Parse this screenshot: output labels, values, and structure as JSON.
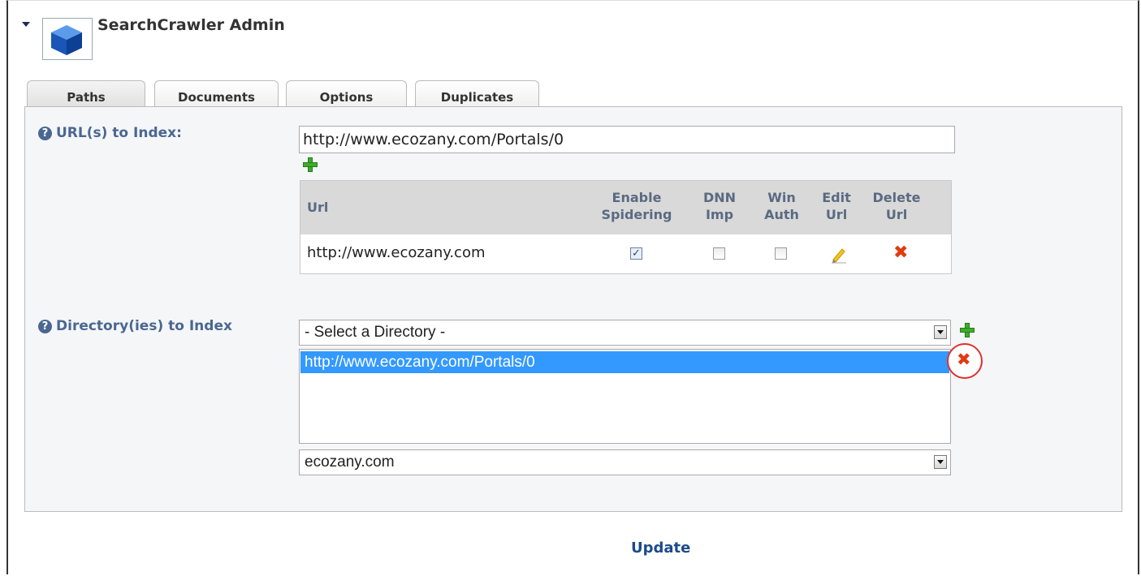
{
  "module": {
    "title": "SearchCrawler Admin",
    "icon": "cube-icon"
  },
  "tabs": [
    {
      "label": "Paths",
      "active": true
    },
    {
      "label": "Documents",
      "active": false
    },
    {
      "label": "Options",
      "active": false
    },
    {
      "label": "Duplicates",
      "active": false
    }
  ],
  "urls_section": {
    "label": "URL(s) to Index:",
    "input_value": "http://www.ecozany.com/Portals/0",
    "table": {
      "headers": {
        "url": "Url",
        "enable_spidering_1": "Enable",
        "enable_spidering_2": "Spidering",
        "dnn_imp_1": "DNN",
        "dnn_imp_2": "Imp",
        "win_auth_1": "Win",
        "win_auth_2": "Auth",
        "edit_url_1": "Edit",
        "edit_url_2": "Url",
        "delete_url_1": "Delete",
        "delete_url_2": "Url"
      },
      "rows": [
        {
          "url": "http://www.ecozany.com",
          "enable_spidering": true,
          "dnn_imp": false,
          "win_auth": false
        }
      ]
    }
  },
  "directories_section": {
    "label": "Directory(ies) to Index",
    "select_value": "- Select a Directory -",
    "list_items": [
      "http://www.ecozany.com/Portals/0"
    ],
    "portal_select_value": "ecozany.com"
  },
  "help_glyph": "?",
  "update_label": "Update",
  "colors": {
    "label": "#4a6791",
    "selection": "#3399ff",
    "add": "#3cad2a",
    "delete": "#e03b10"
  }
}
